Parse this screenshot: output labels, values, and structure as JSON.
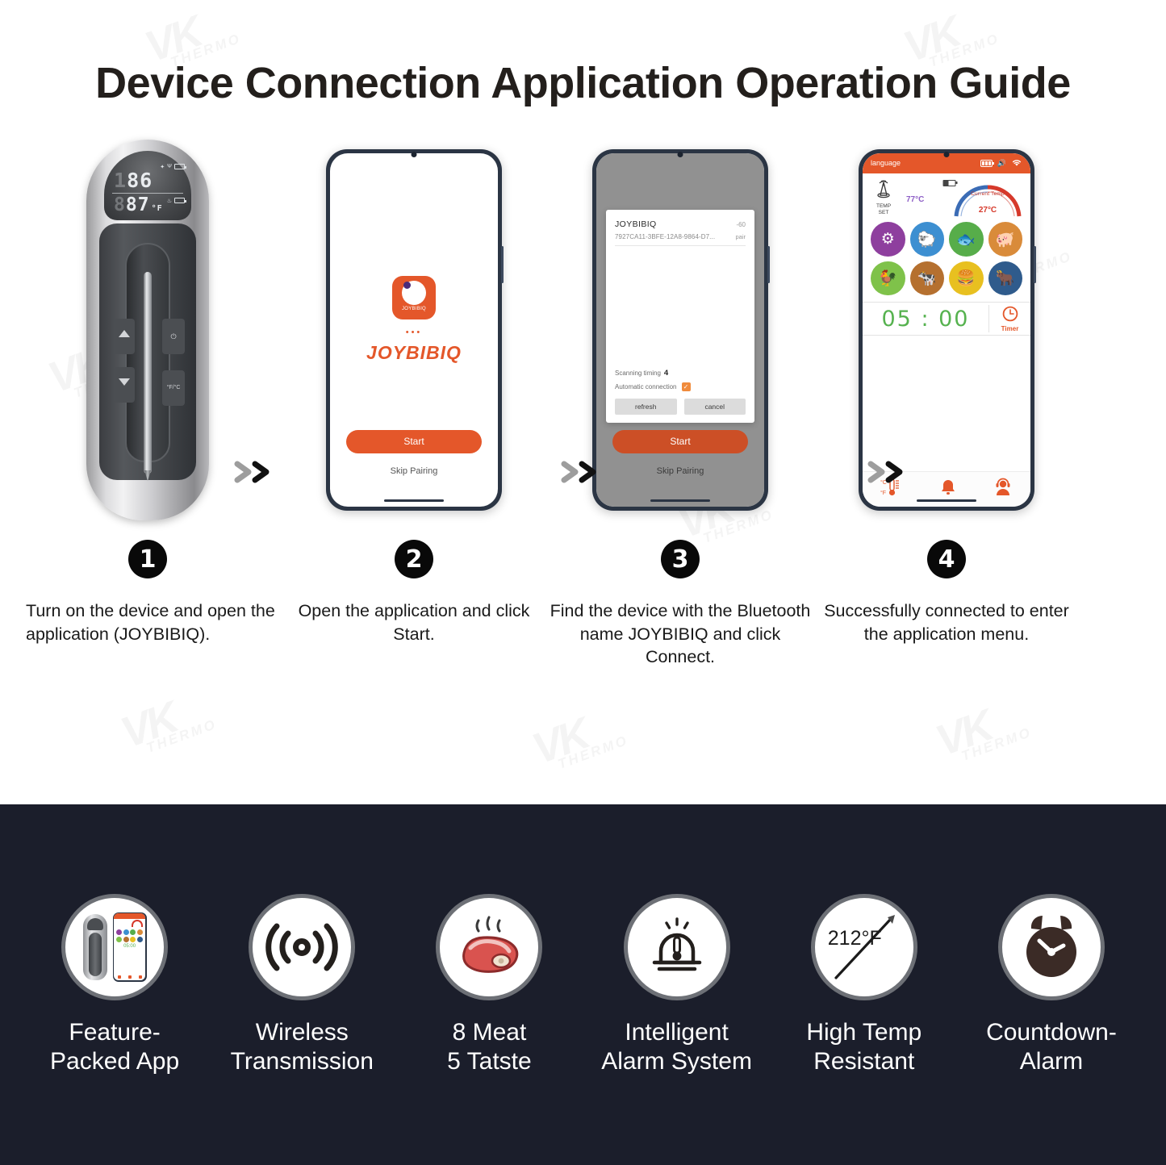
{
  "title": "Device Connection Application Operation Guide",
  "watermark": {
    "big": "VK",
    "small": "THERMO"
  },
  "steps": [
    {
      "number": "1",
      "badge": "❶",
      "caption": "Turn on the device and open the application (JOYBIBIQ).",
      "device": {
        "lcd_top_ghost": "1",
        "lcd_top": "86",
        "lcd_bottom_ghost": "8",
        "lcd_bottom": "87",
        "lcd_unit": "°F",
        "btn_up": "▲",
        "btn_down": "▼",
        "btn_power": "⏻",
        "btn_unit": "°F/°C"
      }
    },
    {
      "number": "2",
      "badge": "❷",
      "caption": "Open the application and click Start.",
      "splash": {
        "app_icon_label": "JOYBIBIQ",
        "dots": "•••",
        "brand": "JOYBIBIQ",
        "start_label": "Start",
        "skip_label": "Skip Pairing"
      }
    },
    {
      "number": "3",
      "badge": "❸",
      "caption": "Find the device with the Bluetooth name JOYBIBIQ and click Connect.",
      "bluetooth": {
        "device_name": "JOYBIBIQ",
        "rssi": "-60",
        "uuid": "7927CA11-3BFE-12A8-9864-D7...",
        "pair_label": "pair",
        "scan_label": "Scanning timing",
        "scan_value": "4",
        "auto_label": "Automatic connection",
        "auto_checked": "✓",
        "refresh_label": "refresh",
        "cancel_label": "cancel",
        "start_label": "Start",
        "skip_label": "Skip Pairing"
      }
    },
    {
      "number": "4",
      "badge": "❹",
      "caption": "Successfully connected to enter the application menu.",
      "menu": {
        "language_label": "language",
        "probe_label_line1": "TEMP",
        "probe_label_line2": "SET",
        "set_temp": "77",
        "set_temp_unit": "°C",
        "current_label": "Current Temp",
        "current_temp": "27",
        "current_temp_unit": "°C",
        "timer_value": "05 : 00",
        "timer_label": "Timer",
        "meats": [
          {
            "name": "program",
            "glyph": "⚙",
            "color": "#8e3f9e"
          },
          {
            "name": "lamb",
            "glyph": "🐑",
            "color": "#3d8fd1"
          },
          {
            "name": "fish",
            "glyph": "🐟",
            "color": "#57ad4a"
          },
          {
            "name": "pork",
            "glyph": "🐖",
            "color": "#d98b3a"
          },
          {
            "name": "chicken",
            "glyph": "🐓",
            "color": "#7fc24a"
          },
          {
            "name": "veal",
            "glyph": "🐄",
            "color": "#b5702f"
          },
          {
            "name": "burger",
            "glyph": "🍔",
            "color": "#e8c020"
          },
          {
            "name": "beef",
            "glyph": "🐂",
            "color": "#2f5b8c"
          }
        ],
        "bottom_nav": [
          {
            "name": "unit-toggle",
            "label": "°C/°F"
          },
          {
            "name": "alarm",
            "label": "bell"
          },
          {
            "name": "support",
            "label": "headset"
          }
        ]
      }
    }
  ],
  "features": [
    {
      "icon": "app-phone-icon",
      "label_line1": "Feature-",
      "label_line2": "Packed App"
    },
    {
      "icon": "wireless-icon",
      "label_line1": "Wireless",
      "label_line2": "Transmission"
    },
    {
      "icon": "meat-icon",
      "label_line1": "8 Meat",
      "label_line2": "5 Tatste"
    },
    {
      "icon": "alarm-system-icon",
      "label_line1": "Intelligent",
      "label_line2": "Alarm System"
    },
    {
      "icon": "high-temp-icon",
      "label_line1": "High Temp",
      "label_line2": "Resistant",
      "temp_text": "212°F"
    },
    {
      "icon": "countdown-icon",
      "label_line1": "Countdown-",
      "label_line2": "Alarm"
    }
  ],
  "colors": {
    "accent_orange": "#e4572a",
    "dark_strip": "#1b1e2b",
    "timer_green": "#56b24f",
    "set_temp_purple": "#8e5fc6",
    "current_temp_red": "#d6392b"
  }
}
